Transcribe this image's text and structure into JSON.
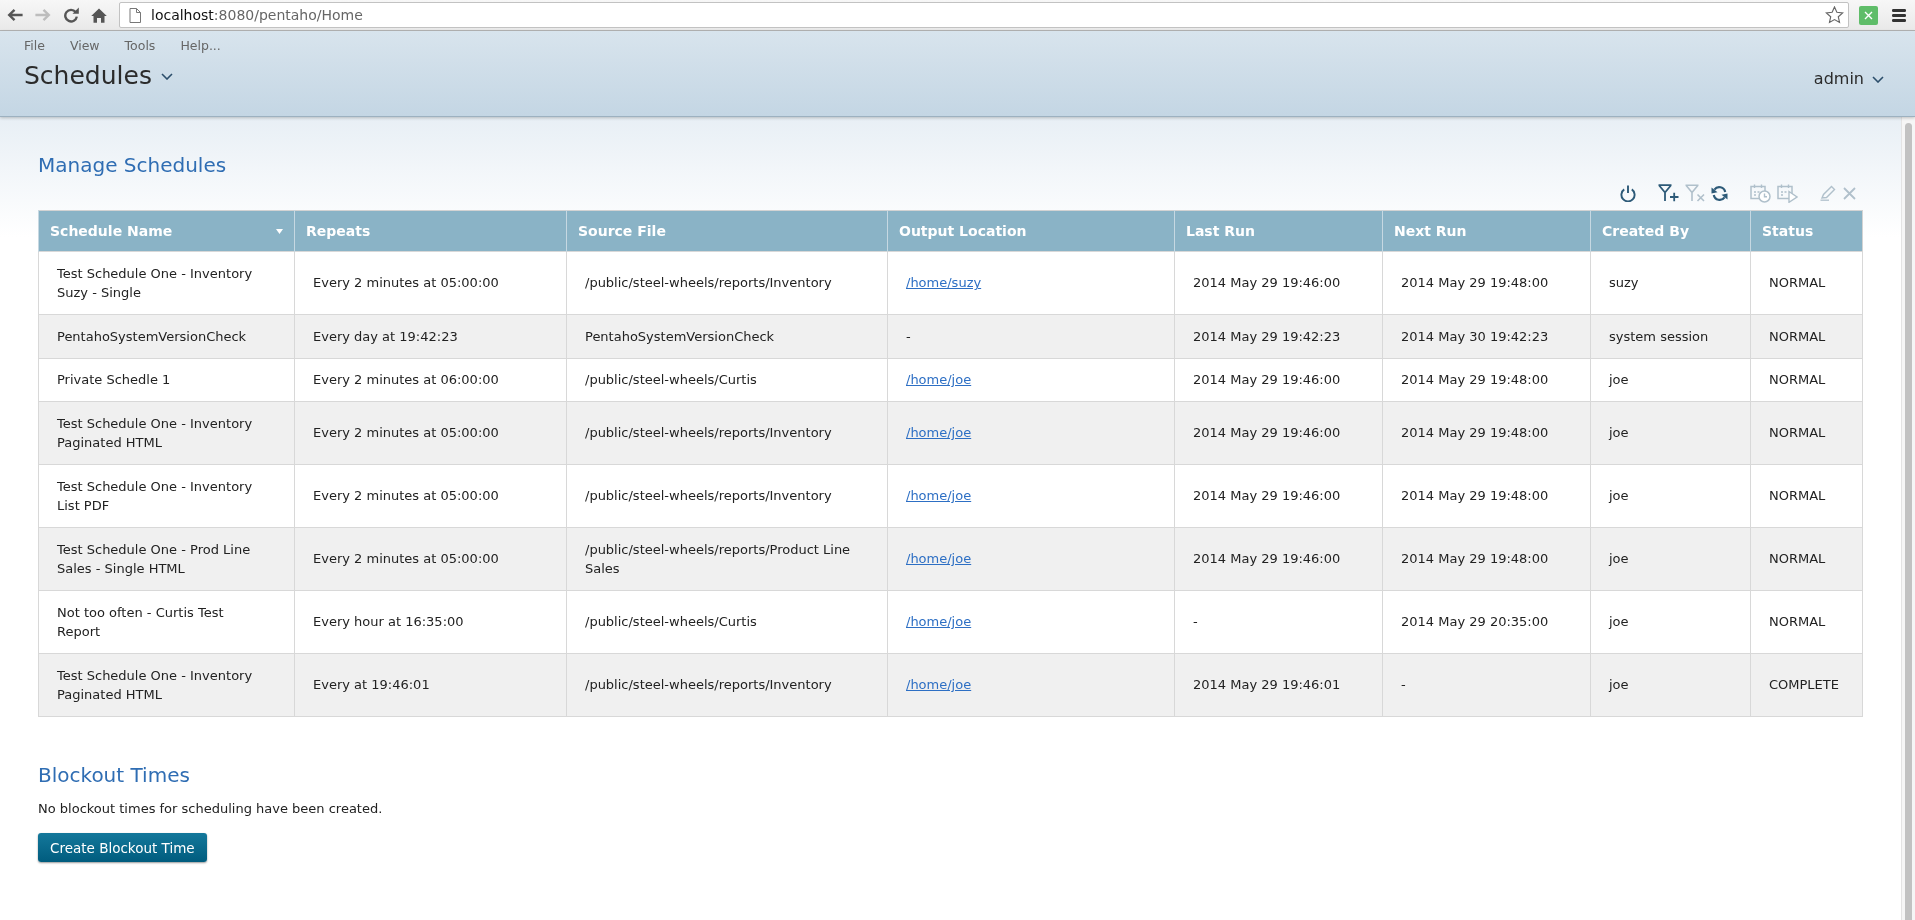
{
  "browser": {
    "nav_buttons": [
      {
        "kind": "back",
        "disabled": false
      },
      {
        "kind": "forward",
        "disabled": true
      },
      {
        "kind": "reload",
        "disabled": false
      },
      {
        "kind": "home",
        "disabled": false
      }
    ],
    "address_bar": {
      "host": "localhost",
      "path": ":8080/pentaho/Home"
    }
  },
  "header": {
    "menu": [
      "File",
      "View",
      "Tools",
      "Help..."
    ],
    "perspective": "Schedules",
    "user": "admin"
  },
  "schedules": {
    "title": "Manage Schedules",
    "toolbar_groups": [
      {
        "buttons": [
          {
            "kind": "power",
            "disabled": false
          }
        ]
      },
      {
        "buttons": [
          {
            "kind": "filter_add",
            "disabled": false
          },
          {
            "kind": "filter_remove",
            "disabled": true
          },
          {
            "kind": "refresh",
            "disabled": false
          }
        ]
      },
      {
        "buttons": [
          {
            "kind": "calendar_clock",
            "disabled": true
          },
          {
            "kind": "calendar_play",
            "disabled": true
          }
        ]
      },
      {
        "buttons": [
          {
            "kind": "pencil",
            "disabled": true
          },
          {
            "kind": "close",
            "disabled": true
          }
        ]
      }
    ],
    "table": {
      "columns": [
        {
          "label": "Schedule Name",
          "sorted": true
        },
        {
          "label": "Repeats",
          "sorted": false
        },
        {
          "label": "Source File",
          "sorted": false
        },
        {
          "label": "Output Location",
          "sorted": false
        },
        {
          "label": "Last Run",
          "sorted": false
        },
        {
          "label": "Next Run",
          "sorted": false
        },
        {
          "label": "Created By",
          "sorted": false
        },
        {
          "label": "Status",
          "sorted": false
        }
      ],
      "rows": [
        {
          "schedule_name": "Test Schedule One - Inventory Suzy - Single",
          "repeats": "Every 2 minutes at 05:00:00",
          "source_file": "/public/steel-wheels/reports/Inventory",
          "output_location": {
            "text": "/home/suzy",
            "link": true
          },
          "last_run": "2014 May 29 19:46:00",
          "next_run": "2014 May 29 19:48:00",
          "created_by": "suzy",
          "status": "NORMAL"
        },
        {
          "schedule_name": "PentahoSystemVersionCheck",
          "repeats": "Every day at 19:42:23",
          "source_file": "PentahoSystemVersionCheck",
          "output_location": {
            "text": "-",
            "link": false
          },
          "last_run": "2014 May 29 19:42:23",
          "next_run": "2014 May 30 19:42:23",
          "created_by": "system session",
          "status": "NORMAL"
        },
        {
          "schedule_name": "Private Schedle 1",
          "repeats": "Every 2 minutes at 06:00:00",
          "source_file": "/public/steel-wheels/Curtis",
          "output_location": {
            "text": "/home/joe",
            "link": true
          },
          "last_run": "2014 May 29 19:46:00",
          "next_run": "2014 May 29 19:48:00",
          "created_by": "joe",
          "status": "NORMAL"
        },
        {
          "schedule_name": "Test Schedule One - Inventory Paginated HTML",
          "repeats": "Every 2 minutes at 05:00:00",
          "source_file": "/public/steel-wheels/reports/Inventory",
          "output_location": {
            "text": "/home/joe",
            "link": true
          },
          "last_run": "2014 May 29 19:46:00",
          "next_run": "2014 May 29 19:48:00",
          "created_by": "joe",
          "status": "NORMAL"
        },
        {
          "schedule_name": "Test Schedule One - Inventory List PDF",
          "repeats": "Every 2 minutes at 05:00:00",
          "source_file": "/public/steel-wheels/reports/Inventory",
          "output_location": {
            "text": "/home/joe",
            "link": true
          },
          "last_run": "2014 May 29 19:46:00",
          "next_run": "2014 May 29 19:48:00",
          "created_by": "joe",
          "status": "NORMAL"
        },
        {
          "schedule_name": "Test Schedule One - Prod Line Sales - Single HTML",
          "repeats": "Every 2 minutes at 05:00:00",
          "source_file": "/public/steel-wheels/reports/Product Line Sales",
          "output_location": {
            "text": "/home/joe",
            "link": true
          },
          "last_run": "2014 May 29 19:46:00",
          "next_run": "2014 May 29 19:48:00",
          "created_by": "joe",
          "status": "NORMAL"
        },
        {
          "schedule_name": "Not too often - Curtis Test Report",
          "repeats": "Every hour at 16:35:00",
          "source_file": "/public/steel-wheels/Curtis",
          "output_location": {
            "text": "/home/joe",
            "link": true
          },
          "last_run": "-",
          "next_run": "2014 May 29 20:35:00",
          "created_by": "joe",
          "status": "NORMAL"
        },
        {
          "schedule_name": "Test Schedule One - Inventory Paginated HTML",
          "repeats": "Every at 19:46:01",
          "source_file": "/public/steel-wheels/reports/Inventory",
          "output_location": {
            "text": "/home/joe",
            "link": true
          },
          "last_run": "2014 May 29 19:46:01",
          "next_run": "-",
          "created_by": "joe",
          "status": "COMPLETE"
        }
      ]
    }
  },
  "blockout": {
    "title": "Blockout Times",
    "message": "No blockout times for scheduling have been created.",
    "button": "Create Blockout Time"
  }
}
